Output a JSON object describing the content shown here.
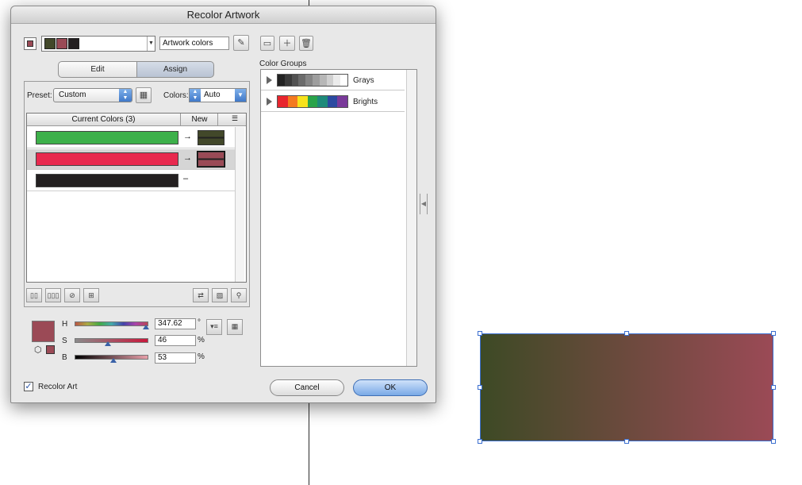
{
  "dialog": {
    "title": "Recolor Artwork"
  },
  "header": {
    "group_name": "Artwork colors",
    "icons": {
      "eyedropper": "eyedropper-icon",
      "save": "save-icon",
      "new_group": "new-folder-icon",
      "delete": "trash-icon"
    }
  },
  "tabs": {
    "edit": "Edit",
    "assign": "Assign",
    "active": "Assign"
  },
  "preset": {
    "label": "Preset:",
    "value": "Custom"
  },
  "colors": {
    "label": "Colors:",
    "value": "Auto"
  },
  "table": {
    "col_current": "Current Colors (3)",
    "col_new": "New",
    "rows": [
      {
        "current": "#3db04a",
        "arrow": "→",
        "new": "#42482a",
        "selected": false
      },
      {
        "current": "#e8294e",
        "arrow": "→",
        "new": "#9a4a56",
        "selected": true
      },
      {
        "current": "#231f20",
        "arrow": "–",
        "new": null,
        "selected": false
      }
    ]
  },
  "hsb": {
    "h_label": "H",
    "h_value": "347.62",
    "h_unit": "°",
    "s_label": "S",
    "s_value": "46",
    "s_unit": "%",
    "b_label": "B",
    "b_value": "53",
    "b_unit": "%",
    "swatch_color": "#9b4a56"
  },
  "color_groups": {
    "title": "Color Groups",
    "groups": [
      {
        "name": "Grays",
        "swatches": [
          "#222222",
          "#3a3a3a",
          "#525252",
          "#6b6b6b",
          "#858585",
          "#9e9e9e",
          "#b7b7b7",
          "#d0d0d0",
          "#ebebeb",
          "#ffffff"
        ]
      },
      {
        "name": "Brights",
        "swatches": [
          "#e8262e",
          "#f47a20",
          "#f7e21c",
          "#2aa34a",
          "#1e8a7a",
          "#2b4aa0",
          "#7a3a9a"
        ]
      }
    ]
  },
  "footer": {
    "recolor_label": "Recolor Art",
    "recolor_checked": true,
    "cancel": "Cancel",
    "ok": "OK"
  },
  "artwork": {
    "gradient_start": "#3d4a25",
    "gradient_end": "#9b4a56"
  }
}
